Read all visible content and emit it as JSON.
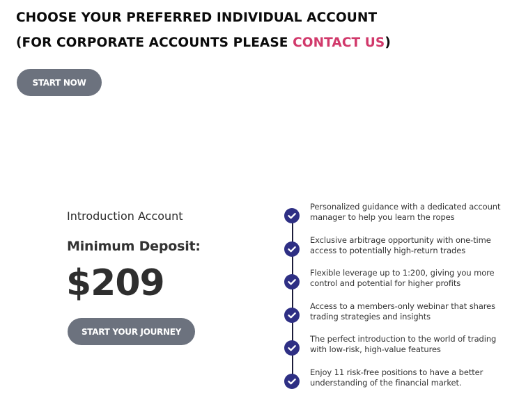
{
  "header": {
    "line1": "CHOOSE YOUR PREFERRED INDIVIDUAL ACCOUNT",
    "line2_prefix": "(FOR CORPORATE ACCOUNTS PLEASE ",
    "line2_link": "CONTACT US",
    "line2_suffix": ")"
  },
  "start_now_label": "START NOW",
  "account": {
    "name": "Introduction Account",
    "deposit_label": "Minimum Deposit:",
    "price": "$209",
    "cta_label": "START YOUR JOURNEY"
  },
  "features": [
    "Personalized guidance with a dedicated account manager to help you learn the ropes",
    "Exclusive arbitrage opportunity with one-time access to potentially high-return trades",
    "Flexible leverage up to 1:200, giving you more control and potential for higher profits",
    "Access to a members-only webinar that shares trading strategies and insights",
    "The perfect introduction to the world of trading with low-risk, high-value features",
    "Enjoy 11 risk-free positions to have a better understanding of the financial market."
  ],
  "colors": {
    "link": "#d1396b",
    "button": "#6c727e",
    "check": "#2e2f84"
  },
  "icons": {
    "feature_marker": "check-circle-icon"
  }
}
